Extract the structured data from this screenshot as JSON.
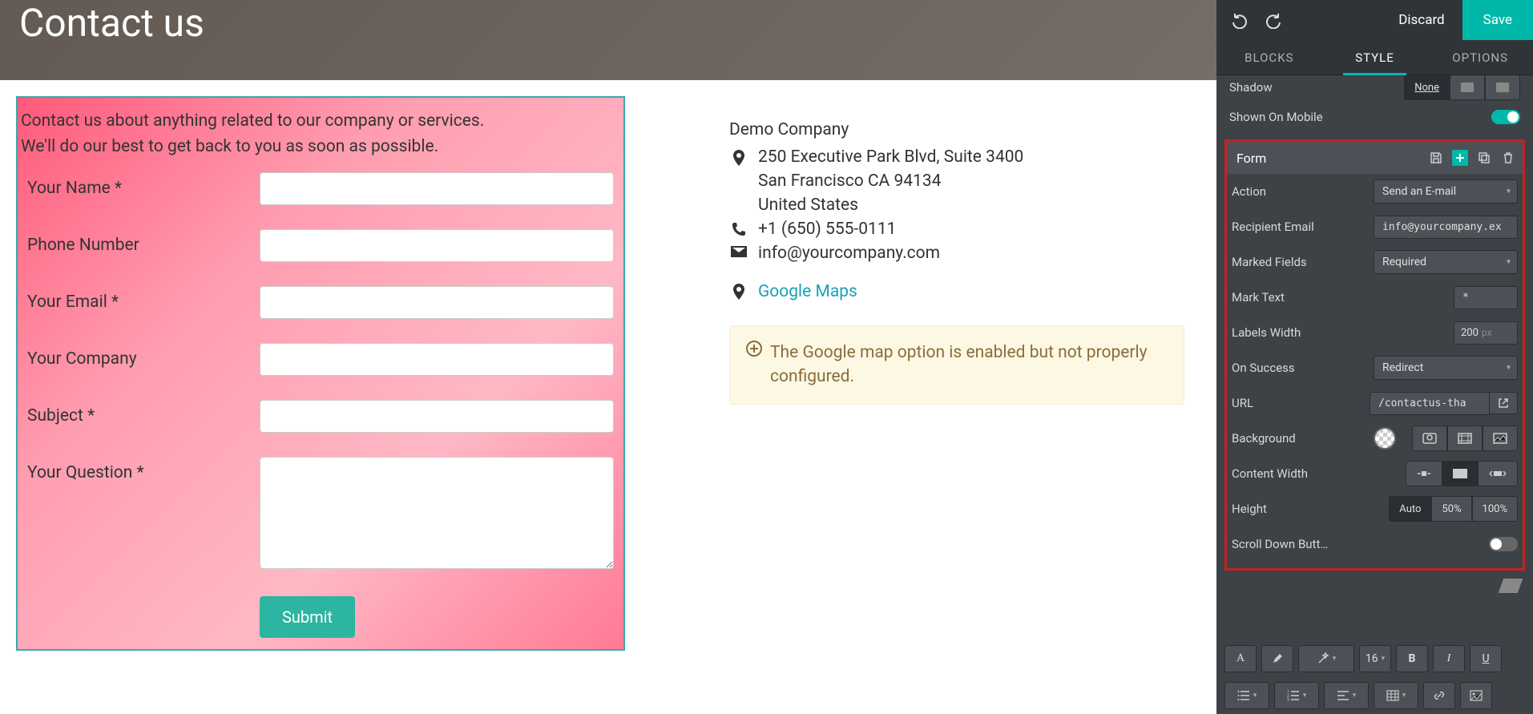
{
  "hero": {
    "title": "Contact us"
  },
  "intro": {
    "line1": "Contact us about anything related to our company or services.",
    "line2": "We'll do our best to get back to you as soon as possible."
  },
  "form": {
    "fields": [
      {
        "label": "Your Name *"
      },
      {
        "label": "Phone Number"
      },
      {
        "label": "Your Email *"
      },
      {
        "label": "Your Company"
      },
      {
        "label": "Subject *"
      },
      {
        "label": "Your Question *"
      }
    ],
    "submit": "Submit"
  },
  "company": {
    "name": "Demo Company",
    "address1": "250 Executive Park Blvd, Suite 3400",
    "address2": "San Francisco CA 94134",
    "address3": "United States",
    "phone": "+1 (650) 555-0111",
    "email": "info@yourcompany.com",
    "maps": "Google Maps"
  },
  "alert": {
    "text": "The Google map option is enabled but not properly configured."
  },
  "panel": {
    "discard": "Discard",
    "save": "Save",
    "tabs": {
      "blocks": "BLOCKS",
      "style": "STYLE",
      "options": "OPTIONS"
    },
    "shadow": {
      "label": "Shadow",
      "value": "None"
    },
    "mobile": {
      "label": "Shown On Mobile"
    },
    "section_title": "Form",
    "action": {
      "label": "Action",
      "value": "Send an E-mail"
    },
    "recipient": {
      "label": "Recipient Email",
      "value": "info@yourcompany.ex"
    },
    "marked": {
      "label": "Marked Fields",
      "value": "Required"
    },
    "mark_text": {
      "label": "Mark Text",
      "value": "*"
    },
    "labels_width": {
      "label": "Labels Width",
      "value": "200",
      "unit": "px"
    },
    "on_success": {
      "label": "On Success",
      "value": "Redirect"
    },
    "url": {
      "label": "URL",
      "value": "/contactus-tha"
    },
    "background": {
      "label": "Background"
    },
    "content_width": {
      "label": "Content Width"
    },
    "height": {
      "label": "Height",
      "opts": [
        "Auto",
        "50%",
        "100%"
      ]
    },
    "scroll": {
      "label": "Scroll Down Butt…"
    },
    "font_size": "16"
  }
}
